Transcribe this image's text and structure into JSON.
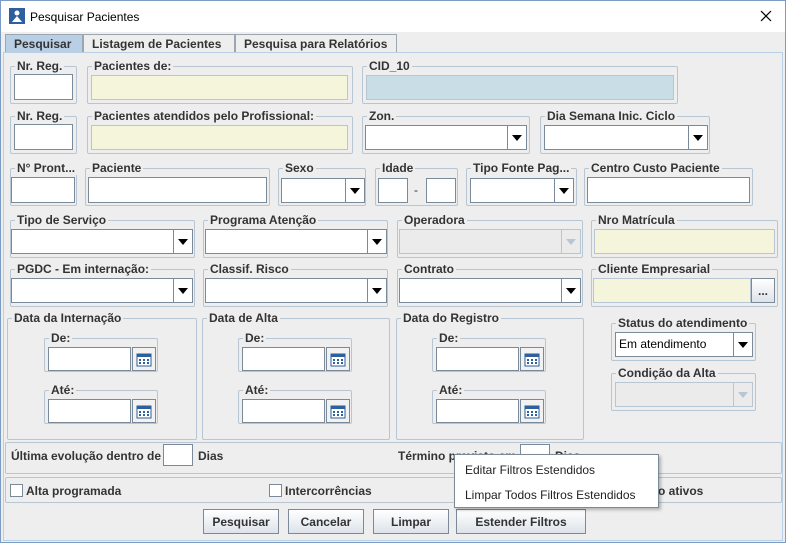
{
  "window": {
    "title": "Pesquisar Pacientes"
  },
  "tabs": [
    {
      "label": "Pesquisar",
      "active": true
    },
    {
      "label": "Listagem de Pacientes",
      "active": false
    },
    {
      "label": "Pesquisa para Relatórios",
      "active": false
    }
  ],
  "row1": {
    "nr_reg": "Nr. Reg.",
    "pacientes_de": "Pacientes de:",
    "cid": "CID_10"
  },
  "row2": {
    "nr_reg": "Nr. Reg.",
    "atendidos": "Pacientes atendidos pelo Profissional:",
    "zon": "Zon.",
    "dia_semana": "Dia Semana Inic. Ciclo"
  },
  "row3": {
    "n_pront": "N° Pront...",
    "paciente": "Paciente",
    "sexo": "Sexo",
    "idade": "Idade",
    "idade_sep": "-",
    "tipo_fonte": "Tipo Fonte Pag...",
    "centro_custo": "Centro Custo Paciente"
  },
  "row4": {
    "tipo_servico": "Tipo de Serviço",
    "programa": "Programa Atenção",
    "operadora": "Operadora",
    "nro_matricula": "Nro Matrícula"
  },
  "row5": {
    "pgdc": "PGDC - Em internação:",
    "classif": "Classif. Risco",
    "contrato": "Contrato",
    "cliente": "Cliente Empresarial",
    "cliente_btn": "..."
  },
  "dates": {
    "internacao": {
      "title": "Data da Internação",
      "de": "De:",
      "ate": "Até:"
    },
    "alta": {
      "title": "Data de Alta",
      "de": "De:",
      "ate": "Até:"
    },
    "registro": {
      "title": "Data do Registro",
      "de": "De:",
      "ate": "Até:"
    }
  },
  "status": {
    "title": "Status do atendimento",
    "value": "Em atendimento"
  },
  "condicao": {
    "title": "Condição da Alta"
  },
  "evolucao": {
    "label": "Última evolução dentro de",
    "suffix": "Dias",
    "termino_label": "Término previsto em",
    "termino_suffix": "Dias"
  },
  "checks": {
    "alta_programada": "Alta programada",
    "intercorrencias": "Intercorrências",
    "ativos": "o ativos"
  },
  "buttons": {
    "pesquisar": "Pesquisar",
    "cancelar": "Cancelar",
    "limpar": "Limpar",
    "estender": "Estender Filtros"
  },
  "popup": {
    "item1": "Editar Filtros Estendidos",
    "item2": "Limpar Todos Filtros Estendidos"
  }
}
